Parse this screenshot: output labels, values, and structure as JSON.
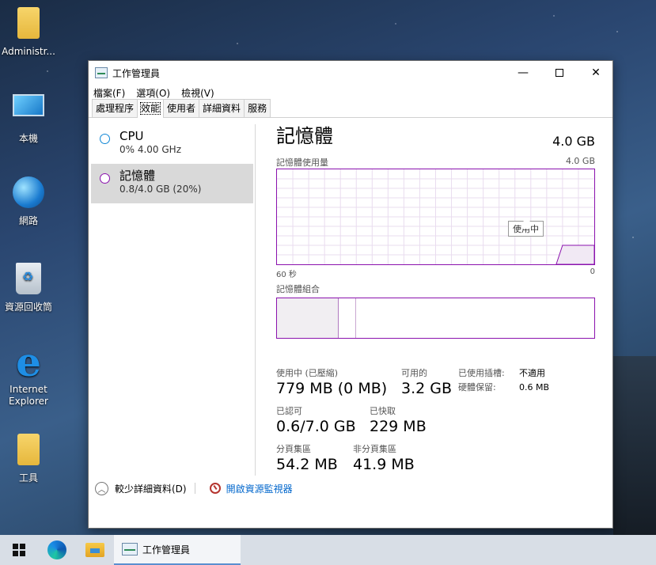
{
  "desktop": {
    "icons": [
      {
        "label": "Administr...",
        "icon": "user-folder-icon"
      },
      {
        "label": "本機",
        "icon": "computer-icon"
      },
      {
        "label": "網路",
        "icon": "network-icon"
      },
      {
        "label": "資源回收筒",
        "icon": "recycle-bin-icon"
      },
      {
        "label": "Internet Explorer",
        "icon": "internet-explorer-icon"
      },
      {
        "label": "工具",
        "icon": "folder-icon"
      }
    ]
  },
  "window": {
    "title": "工作管理員",
    "controls": {
      "minimize": "—",
      "maximize": "☐",
      "close": "✕"
    }
  },
  "menu": [
    "檔案(F)",
    "選項(O)",
    "檢視(V)"
  ],
  "tabs": [
    {
      "label": "處理程序",
      "active": false
    },
    {
      "label": "效能",
      "active": true
    },
    {
      "label": "使用者",
      "active": false
    },
    {
      "label": "詳細資料",
      "active": false
    },
    {
      "label": "服務",
      "active": false
    }
  ],
  "sidebar": {
    "items": [
      {
        "title": "CPU",
        "subtitle": "0% 4.00 GHz",
        "color": "#1187d6",
        "selected": false
      },
      {
        "title": "記憶體",
        "subtitle": "0.8/4.0 GB (20%)",
        "color": "#8b12ae",
        "selected": true
      }
    ]
  },
  "memory": {
    "title": "記憶體",
    "total": "4.0 GB",
    "usage_label": "記憶體使用量",
    "usage_max": "4.0 GB",
    "time_left": "60 秒",
    "time_right": "0",
    "composition_label": "記憶體組合",
    "tooltip": "使用中",
    "accent": "#8b12ae",
    "usage_history_fraction": [
      0,
      0,
      0,
      0,
      0,
      0,
      0,
      0,
      0,
      0,
      0,
      0,
      0,
      0,
      0,
      0,
      0,
      0,
      0,
      0,
      0.2,
      0.2,
      0.2
    ]
  },
  "stats": {
    "in_use_label": "使用中 (已壓縮)",
    "in_use_value": "779 MB (0 MB)",
    "available_label": "可用的",
    "available_value": "3.2 GB",
    "committed_label": "已認可",
    "committed_value": "0.6/7.0 GB",
    "cached_label": "已快取",
    "cached_value": "229 MB",
    "paged_label": "分頁集區",
    "paged_value": "54.2 MB",
    "nonpaged_label": "非分頁集區",
    "nonpaged_value": "41.9 MB",
    "slots_label": "已使用插槽:",
    "slots_value": "不適用",
    "reserved_label": "硬體保留:",
    "reserved_value": "0.6 MB"
  },
  "footer": {
    "less_details": "較少詳細資料(D)",
    "open_monitor": "開啟資源監視器"
  },
  "taskbar": {
    "task_label": "工作管理員"
  }
}
